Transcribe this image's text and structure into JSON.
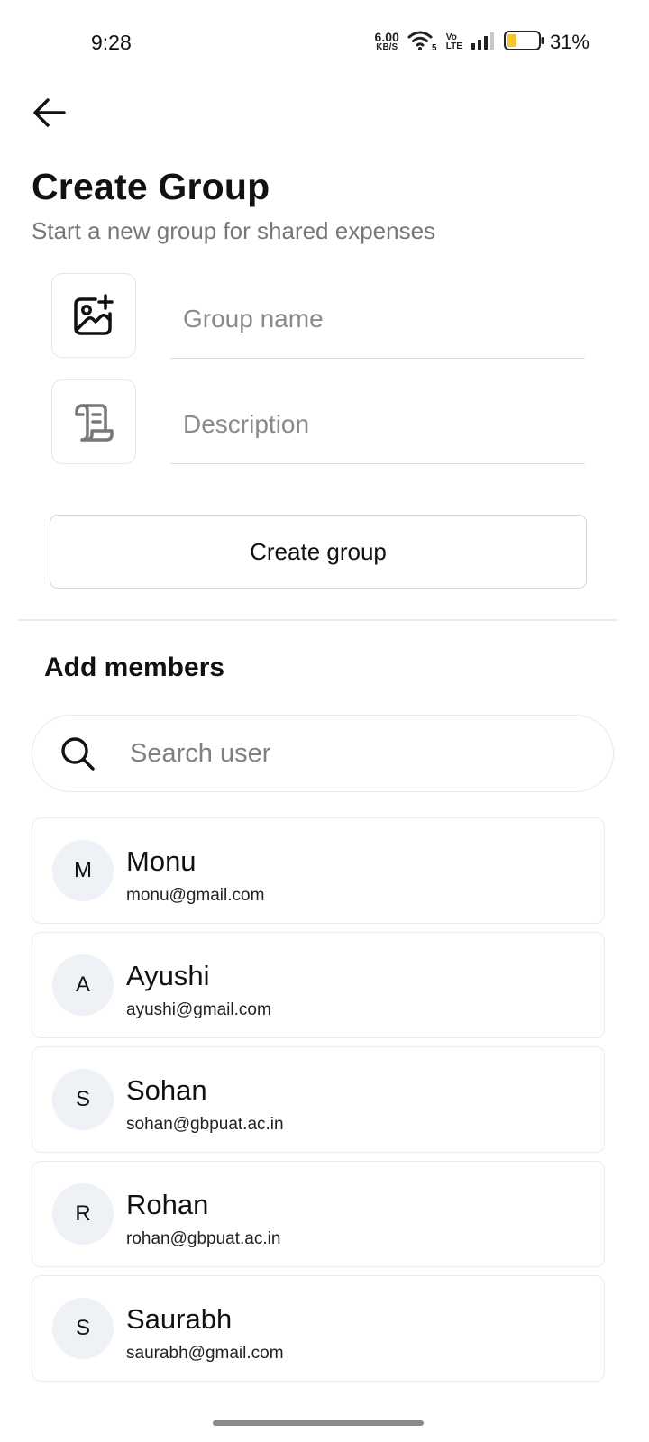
{
  "status_bar": {
    "time": "9:28",
    "net_speed_value": "6.00",
    "net_speed_unit": "KB/S",
    "volte_top": "Vo",
    "volte_bottom": "LTE",
    "battery_percent": "31%",
    "battery_level": 0.31,
    "battery_color": "#f6c431"
  },
  "header": {
    "back_icon": "arrow-left-icon",
    "title": "Create Group",
    "subtitle": "Start a new group for shared expenses"
  },
  "form": {
    "image_icon": "image-add-icon",
    "name_placeholder": "Group name",
    "name_value": "",
    "description_icon": "scroll-icon",
    "description_placeholder": "Description",
    "description_value": "",
    "create_label": "Create group"
  },
  "members": {
    "title": "Add members",
    "search_icon": "search-icon",
    "search_placeholder": "Search user",
    "search_value": "",
    "users": [
      {
        "initial": "M",
        "name": "Monu",
        "email": "monu@gmail.com"
      },
      {
        "initial": "A",
        "name": "Ayushi",
        "email": "ayushi@gmail.com"
      },
      {
        "initial": "S",
        "name": "Sohan",
        "email": "sohan@gbpuat.ac.in"
      },
      {
        "initial": "R",
        "name": "Rohan",
        "email": "rohan@gbpuat.ac.in"
      },
      {
        "initial": "S",
        "name": "Saurabh",
        "email": "saurabh@gmail.com"
      }
    ]
  }
}
